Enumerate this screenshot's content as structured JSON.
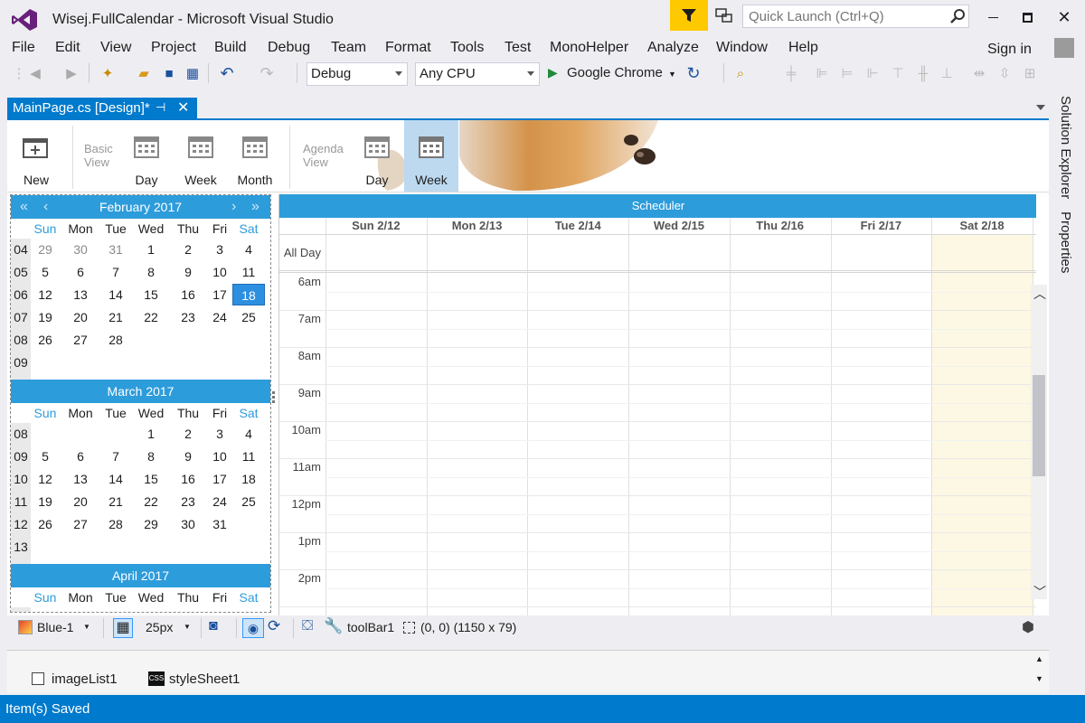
{
  "window": {
    "title": "Wisej.FullCalendar - Microsoft Visual Studio",
    "quick_launch_placeholder": "Quick Launch (Ctrl+Q)",
    "sign_in": "Sign in"
  },
  "menu": [
    "File",
    "Edit",
    "View",
    "Project",
    "Build",
    "Debug",
    "Team",
    "Format",
    "Tools",
    "Test",
    "MonoHelper",
    "Analyze",
    "Window",
    "Help"
  ],
  "toolbar": {
    "config": "Debug",
    "platform": "Any CPU",
    "run_target": "Google Chrome"
  },
  "document_tab": {
    "label": "MainPage.cs [Design]*"
  },
  "side_tabs": [
    "Solution Explorer",
    "Properties"
  ],
  "ribbon": {
    "new_label": "New",
    "basic_view_group": "Basic View",
    "basic_day": "Day",
    "basic_week": "Week",
    "basic_month": "Month",
    "agenda_view_group": "Agenda View",
    "agenda_day": "Day",
    "agenda_week": "Week"
  },
  "mini_calendar": {
    "dow": [
      "Sun",
      "Mon",
      "Tue",
      "Wed",
      "Thu",
      "Fri",
      "Sat"
    ],
    "months": [
      {
        "title": "February 2017",
        "weeks": [
          {
            "num": "04",
            "days": [
              "29",
              "30",
              "31",
              "1",
              "2",
              "3",
              "4"
            ],
            "dim": [
              0,
              1,
              2
            ]
          },
          {
            "num": "05",
            "days": [
              "5",
              "6",
              "7",
              "8",
              "9",
              "10",
              "11"
            ]
          },
          {
            "num": "06",
            "days": [
              "12",
              "13",
              "14",
              "15",
              "16",
              "17",
              "18"
            ],
            "selected": 6
          },
          {
            "num": "07",
            "days": [
              "19",
              "20",
              "21",
              "22",
              "23",
              "24",
              "25"
            ]
          },
          {
            "num": "08",
            "days": [
              "26",
              "27",
              "28",
              "",
              "",
              "",
              ""
            ]
          },
          {
            "num": "09",
            "days": [
              "",
              "",
              "",
              "",
              "",
              "",
              ""
            ]
          }
        ]
      },
      {
        "title": "March 2017",
        "weeks": [
          {
            "num": "08",
            "days": [
              "",
              "",
              "",
              "1",
              "2",
              "3",
              "4"
            ]
          },
          {
            "num": "09",
            "days": [
              "5",
              "6",
              "7",
              "8",
              "9",
              "10",
              "11"
            ]
          },
          {
            "num": "10",
            "days": [
              "12",
              "13",
              "14",
              "15",
              "16",
              "17",
              "18"
            ]
          },
          {
            "num": "11",
            "days": [
              "19",
              "20",
              "21",
              "22",
              "23",
              "24",
              "25"
            ]
          },
          {
            "num": "12",
            "days": [
              "26",
              "27",
              "28",
              "29",
              "30",
              "31",
              ""
            ]
          },
          {
            "num": "13",
            "days": [
              "",
              "",
              "",
              "",
              "",
              "",
              ""
            ]
          }
        ]
      },
      {
        "title": "April 2017",
        "weeks": []
      }
    ]
  },
  "scheduler": {
    "title": "Scheduler",
    "all_day": "All Day",
    "columns": [
      "Sun 2/12",
      "Mon 2/13",
      "Tue 2/14",
      "Wed 2/15",
      "Thu 2/16",
      "Fri 2/17",
      "Sat 2/18"
    ],
    "times": [
      "6am",
      "7am",
      "8am",
      "9am",
      "10am",
      "11am",
      "12pm",
      "1pm",
      "2pm"
    ],
    "today_color": "#fcf8e3"
  },
  "design_toolbar": {
    "theme": "Blue-1",
    "grid_size": "25px",
    "selected_component": "toolBar1",
    "position": "(0, 0) (1150 x 79)"
  },
  "component_tray": [
    "imageList1",
    "styleSheet1"
  ],
  "status": "Item(s) Saved",
  "colors": {
    "accent": "#007acc",
    "calendar_header": "#2d9cdb",
    "vs_purple": "#68217a",
    "filter_yellow": "#ffc900"
  }
}
